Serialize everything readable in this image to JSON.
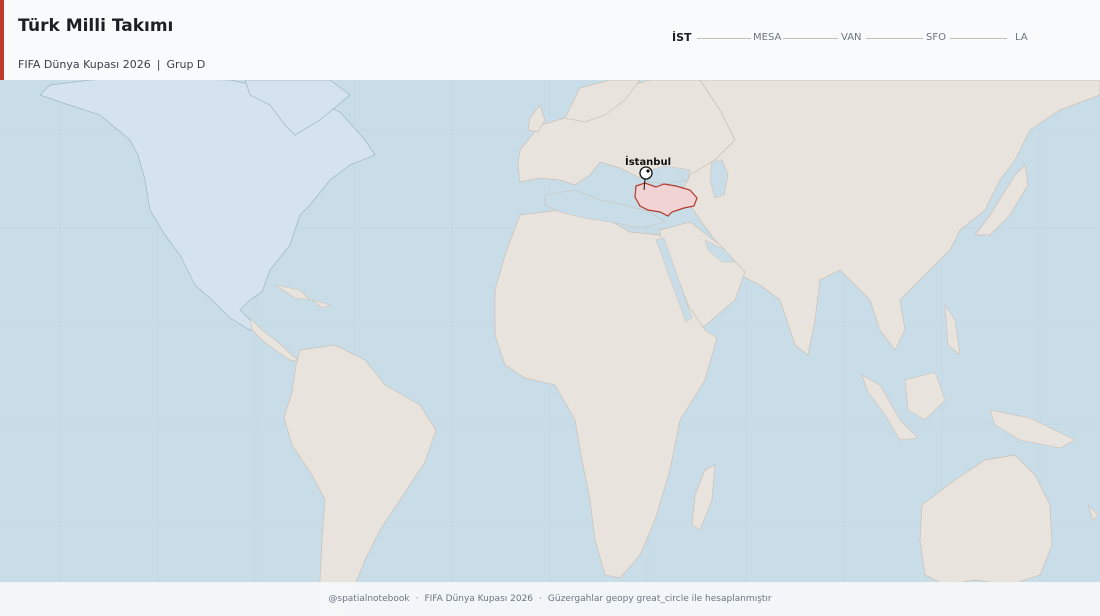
{
  "header": {
    "title": "Türk Milli Takımı",
    "subtitle_tournament": "FIFA Dünya Kupası 2026",
    "subtitle_separator": "|",
    "subtitle_group": "Grup D"
  },
  "route": {
    "stops": [
      {
        "code": "İST",
        "current": true
      },
      {
        "code": "MESA",
        "current": false
      },
      {
        "code": "VAN",
        "current": false
      },
      {
        "code": "SFO",
        "current": false
      },
      {
        "code": "LA",
        "current": false
      }
    ]
  },
  "map": {
    "highlighted_country": "Turkey",
    "city_label": "İstanbul",
    "city_lon": 28.98,
    "city_lat": 41.01,
    "colors": {
      "ocean": "#c9dde8",
      "land": "#e8e3dd",
      "north_america": "#d4e3ef",
      "highlight_fill": "#f2d3d3",
      "highlight_stroke": "#b03a2e",
      "border": "#c9c1b8"
    }
  },
  "footer": {
    "handle": "@spatialnotebook",
    "tournament": "FIFA Dünya Kupası 2026",
    "note": "Güzergahlar geopy great_circle ile hesaplanmıştır",
    "separator": "·"
  }
}
